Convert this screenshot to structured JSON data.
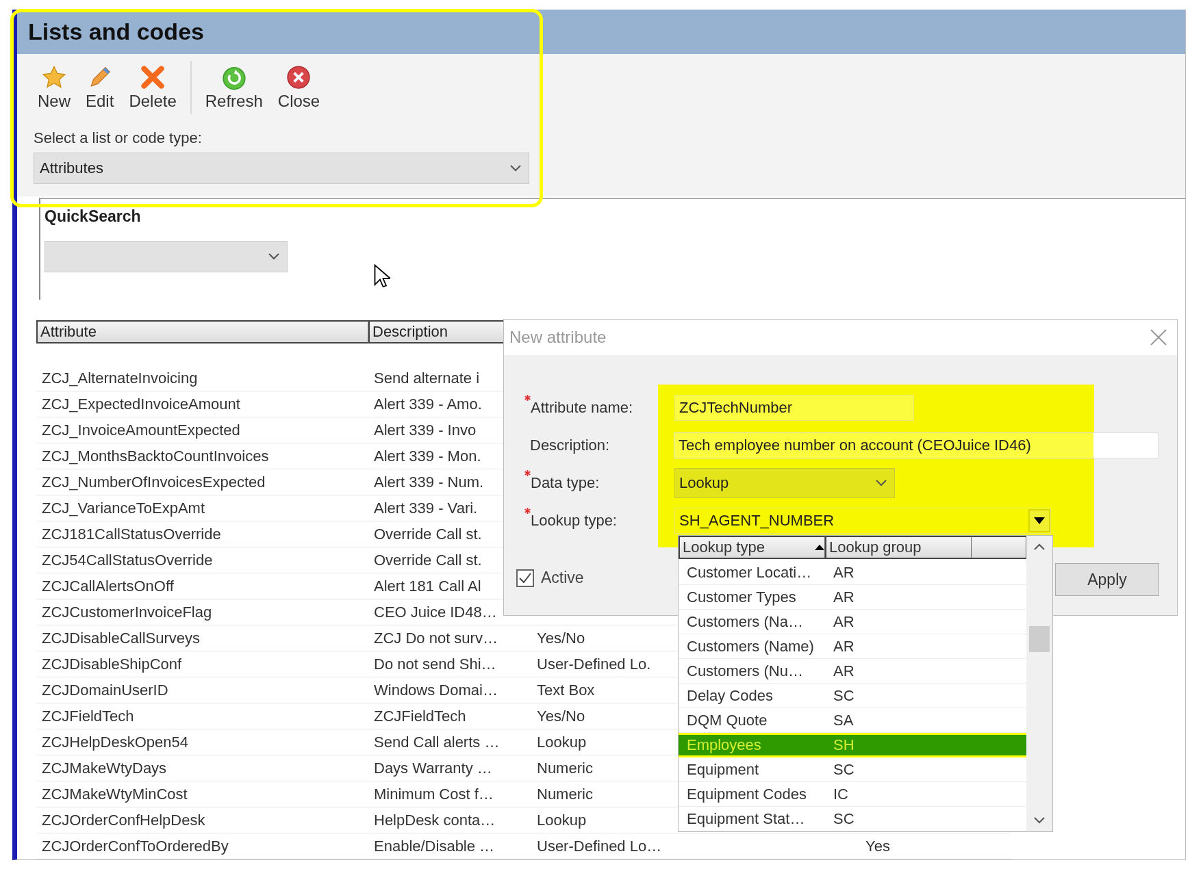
{
  "header": {
    "title": "Lists and codes"
  },
  "toolbar": {
    "groups": [
      [
        {
          "label": "New",
          "kind": "star"
        },
        {
          "label": "Edit",
          "kind": "pencil"
        },
        {
          "label": "Delete",
          "kind": "delete"
        }
      ],
      [
        {
          "label": "Refresh",
          "kind": "refresh"
        },
        {
          "label": "Close",
          "kind": "close"
        }
      ]
    ]
  },
  "list_type": {
    "label": "Select a list or code type:",
    "value": "Attributes"
  },
  "quick_search": {
    "label": "QuickSearch"
  },
  "table": {
    "columns": [
      "Attribute",
      "Description"
    ],
    "rows": [
      {
        "cells": [
          "ZCJ_AlternateInvoicing",
          "Send alternate i"
        ]
      },
      {
        "cells": [
          "ZCJ_ExpectedInvoiceAmount",
          "Alert 339 - Amo."
        ]
      },
      {
        "cells": [
          "ZCJ_InvoiceAmountExpected",
          "Alert 339 - Invo"
        ]
      },
      {
        "cells": [
          "ZCJ_MonthsBacktoCountInvoices",
          "Alert 339 - Mon."
        ]
      },
      {
        "cells": [
          "ZCJ_NumberOfInvoicesExpected",
          "Alert 339 - Num."
        ]
      },
      {
        "cells": [
          "ZCJ_VarianceToExpAmt",
          "Alert 339 - Vari."
        ]
      },
      {
        "cells": [
          "ZCJ181CallStatusOverride",
          "Override Call st."
        ]
      },
      {
        "cells": [
          "ZCJ54CallStatusOverride",
          "Override Call st."
        ]
      },
      {
        "cells": [
          "ZCJCallAlertsOnOff",
          "Alert 181 Call Al"
        ]
      },
      {
        "cells": [
          "ZCJCustomerInvoiceFlag",
          "CEO Juice ID48…"
        ]
      },
      {
        "cells": [
          "ZCJDisableCallSurveys",
          "ZCJ Do not surv…",
          "Yes/No"
        ]
      },
      {
        "cells": [
          "ZCJDisableShipConf",
          "Do not send Shi…",
          "User-Defined Lo."
        ]
      },
      {
        "cells": [
          "ZCJDomainUserID",
          "Windows Domai…",
          "Text Box"
        ]
      },
      {
        "cells": [
          "ZCJFieldTech",
          "ZCJFieldTech",
          "Yes/No"
        ]
      },
      {
        "cells": [
          "ZCJHelpDeskOpen54",
          "Send Call alerts …",
          "Lookup"
        ]
      },
      {
        "cells": [
          "ZCJMakeWtyDays",
          "Days Warranty …",
          "Numeric"
        ]
      },
      {
        "cells": [
          "ZCJMakeWtyMinCost",
          "Minimum Cost f…",
          "Numeric"
        ]
      },
      {
        "cells": [
          "ZCJOrderConfHelpDesk",
          "HelpDesk conta…",
          "Lookup"
        ]
      },
      {
        "cells": [
          "ZCJOrderConfToOrderedBy",
          "Enable/Disable …",
          "User-Defined Lo…",
          "Yes"
        ]
      }
    ]
  },
  "dialog": {
    "title": "New attribute",
    "fields": [
      {
        "label": "Attribute name:",
        "required": true,
        "value": "ZCJTechNumber",
        "kind": "text"
      },
      {
        "label": "Description:",
        "required": false,
        "value": "Tech employee number on account (CEOJuice ID46)",
        "kind": "wide"
      },
      {
        "label": "Data type:",
        "required": true,
        "value": "Lookup",
        "kind": "combo"
      },
      {
        "label": "Lookup type:",
        "required": true,
        "value": "SH_AGENT_NUMBER",
        "kind": "lookup"
      }
    ],
    "active": {
      "label": "Active",
      "checked": true
    },
    "apply_button": "Apply",
    "lookup_list": {
      "columns": [
        "Lookup type",
        "Lookup group"
      ],
      "rows": [
        {
          "cells": [
            "Customer Locati…",
            "AR"
          ],
          "selected": false
        },
        {
          "cells": [
            "Customer Types",
            "AR"
          ],
          "selected": false
        },
        {
          "cells": [
            "Customers (Na…",
            "AR"
          ],
          "selected": false
        },
        {
          "cells": [
            "Customers (Name)",
            "AR"
          ],
          "selected": false
        },
        {
          "cells": [
            "Customers (Nu…",
            "AR"
          ],
          "selected": false
        },
        {
          "cells": [
            "Delay Codes",
            "SC"
          ],
          "selected": false
        },
        {
          "cells": [
            "DQM Quote",
            "SA"
          ],
          "selected": false
        },
        {
          "cells": [
            "Employees",
            "SH"
          ],
          "selected": true
        },
        {
          "cells": [
            "Equipment",
            "SC"
          ],
          "selected": false
        },
        {
          "cells": [
            "Equipment Codes",
            "IC"
          ],
          "selected": false
        },
        {
          "cells": [
            "Equipment Stat…",
            "SC"
          ],
          "selected": false
        }
      ]
    }
  }
}
